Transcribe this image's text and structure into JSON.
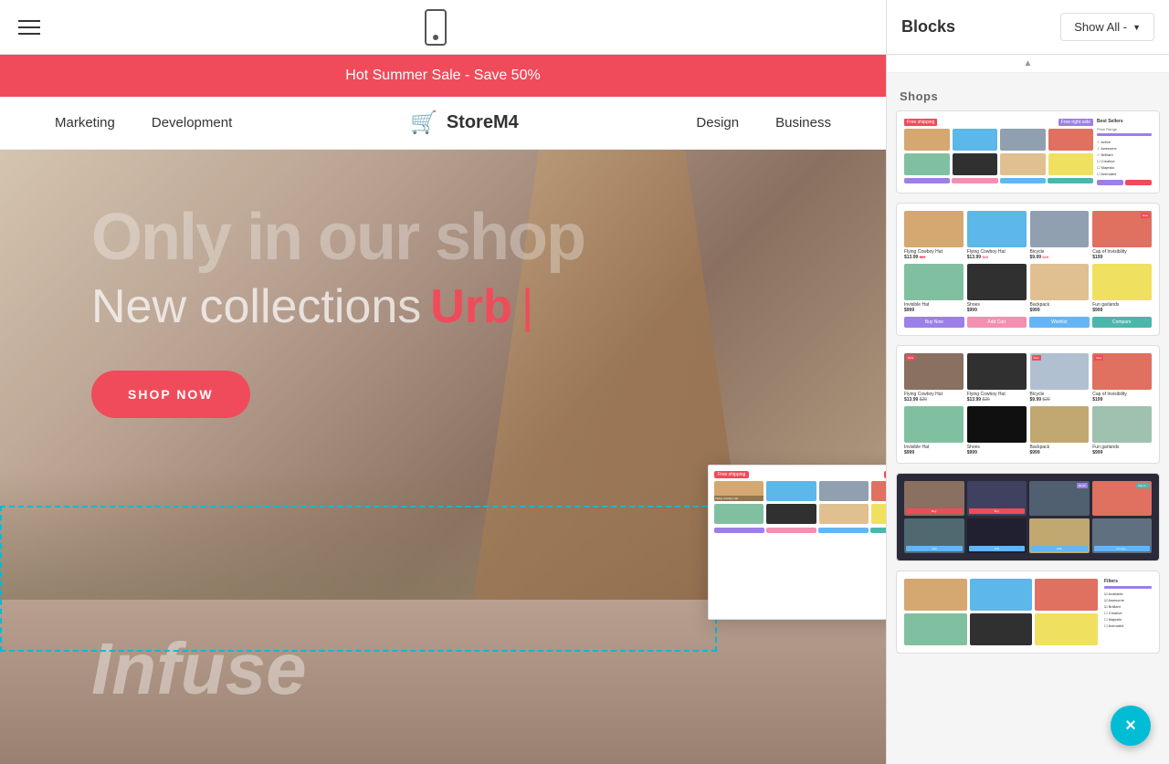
{
  "toolbar": {
    "show_all_label": "Show All ▾"
  },
  "right_panel": {
    "title": "Blocks",
    "show_all_button": "Show All -",
    "section_title": "Shops"
  },
  "announcement": {
    "text": "Hot Summer Sale - Save 50%"
  },
  "nav": {
    "links": [
      "Marketing",
      "Development",
      "Design",
      "Business"
    ],
    "logo_text": "StoreM4"
  },
  "hero": {
    "title_big": "Only in our shop",
    "subtitle_prefix": "New collections ",
    "subtitle_accent": "Urb",
    "cta_label": "SHOP NOW"
  },
  "blocks": [
    {
      "id": 1,
      "type": "shop-with-sidebar"
    },
    {
      "id": 2,
      "type": "shop-grid-simple"
    },
    {
      "id": 3,
      "type": "shop-grid-dark"
    },
    {
      "id": 4,
      "type": "shop-grid-sidebar"
    }
  ]
}
